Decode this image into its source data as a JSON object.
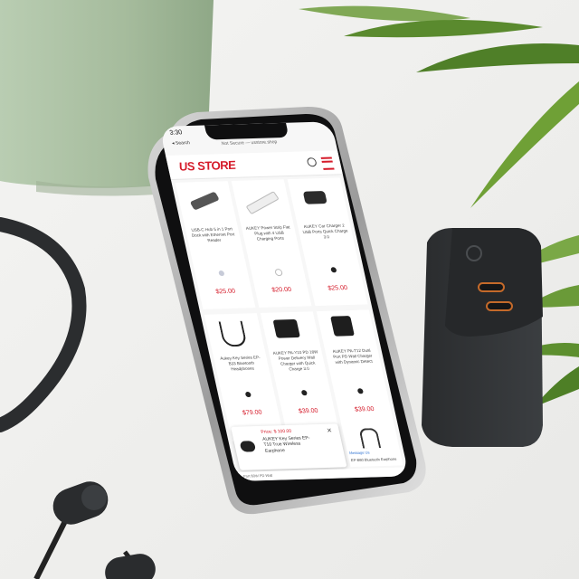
{
  "status_bar": {
    "time": "3:30",
    "back_label": "◂ Search"
  },
  "address_bar": {
    "url": "Not Secure — usstore.shop"
  },
  "store": {
    "logo_text": "US STORE"
  },
  "products": [
    {
      "name": "USB-C Hub 5 in 1 Port Dock with Ethernet Port Reader",
      "price": "$25.00"
    },
    {
      "name": "AUKEY Power Strip Flat Plug with 4 USB Charging Ports",
      "price": "$20.00"
    },
    {
      "name": "AUKEY Car Charger 2 USB Ports Quick Charge 3.0",
      "price": "$25.00"
    },
    {
      "name": "Aukey Key Series EP-B33 Bluetooth Headphones",
      "price": "$79.00"
    },
    {
      "name": "AUKEY PA-Y10 PD 18W Power Delivery Wall Charger with Quick Charge 3.0",
      "price": "$39.00"
    },
    {
      "name": "AUKEY PA-T12 Dual Port PD Wall Charger with Dynamic Detect",
      "price": "$39.00"
    }
  ],
  "popup": {
    "price_line": "Price: $ 100.00",
    "title": "AUKEY Key Series EP-T10 True Wireless Earphone",
    "close": "×"
  },
  "partial_item": {
    "label": "EP-B60 Bluetooth Earphone",
    "badge": "Message Us"
  },
  "footer_text": "Port 60W PD Wall"
}
